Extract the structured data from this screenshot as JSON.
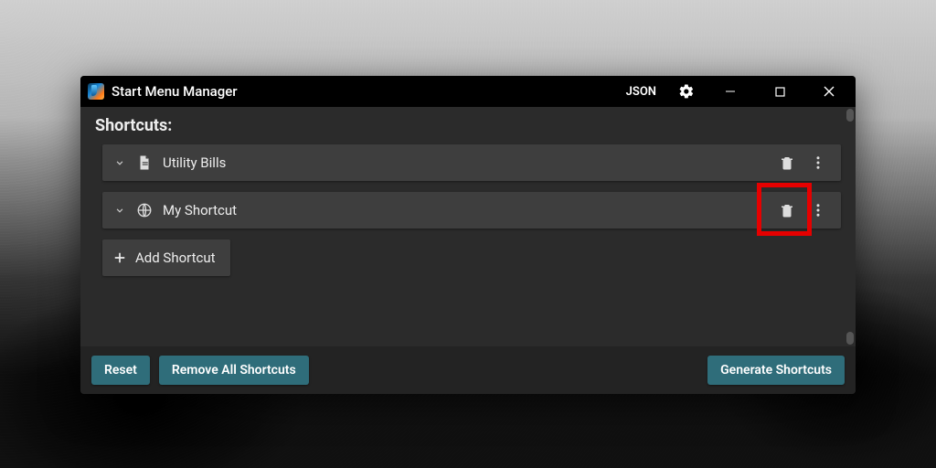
{
  "titlebar": {
    "app_title": "Start Menu Manager",
    "json_label": "JSON"
  },
  "section": {
    "title": "Shortcuts:"
  },
  "shortcuts": [
    {
      "label": "Utility Bills",
      "icon": "document"
    },
    {
      "label": "My Shortcut",
      "icon": "globe",
      "highlighted_delete": true
    }
  ],
  "add_button": {
    "label": "Add Shortcut"
  },
  "footer": {
    "reset": "Reset",
    "remove_all": "Remove All Shortcuts",
    "generate": "Generate Shortcuts"
  }
}
